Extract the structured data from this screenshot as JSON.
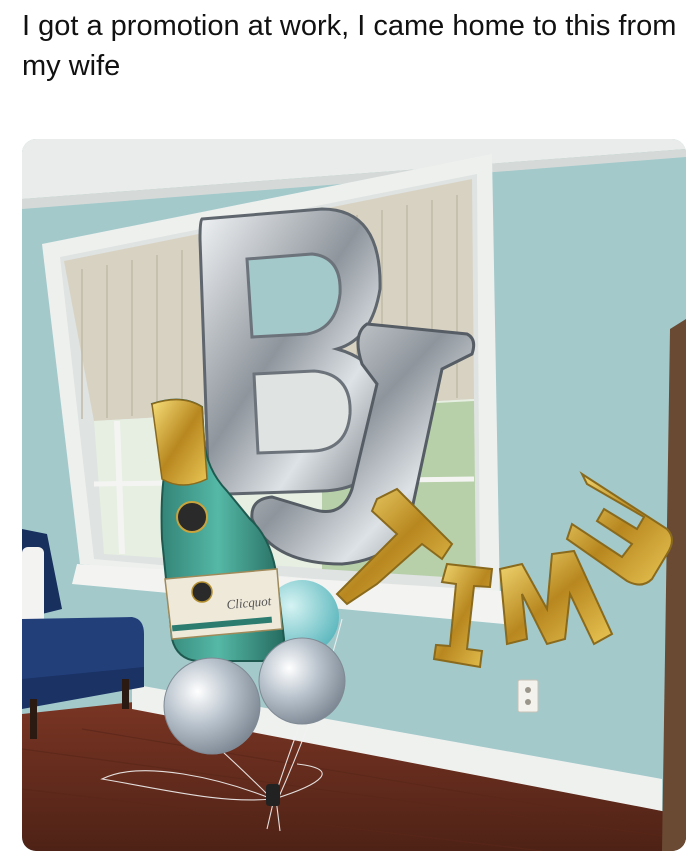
{
  "post": {
    "caption": "I got a promotion at work, I came home to this from my wife"
  },
  "photo": {
    "balloon_letters": [
      "B",
      "J",
      "T",
      "I",
      "M",
      "E"
    ],
    "champagne_label": "Clicquot",
    "colors": {
      "wall": "#9fc6c8",
      "floor": "#6b2e1f",
      "silver": "#c9ced3",
      "gold": "#d8b23a",
      "bottle": "#3e9b8c",
      "chair": "#1f3c73"
    }
  }
}
